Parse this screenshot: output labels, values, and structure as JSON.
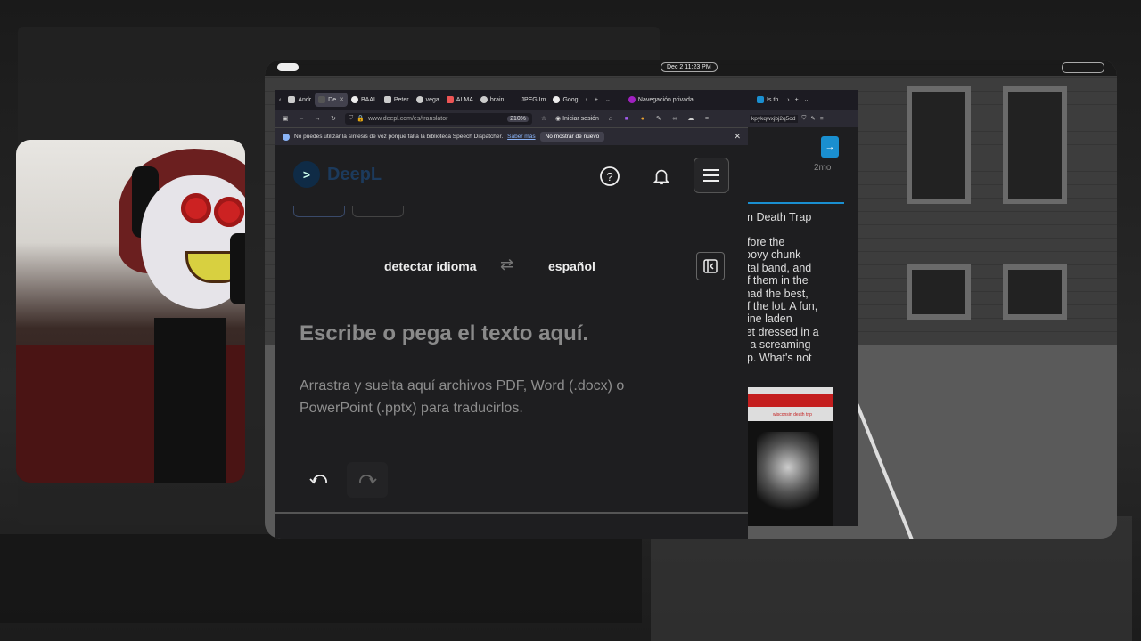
{
  "topbar": {
    "clock": "Dec 2  11:23 PM"
  },
  "browser": {
    "tabs": [
      {
        "label": "Andr",
        "active": false
      },
      {
        "label": "De",
        "active": true
      },
      {
        "label": "BAAL",
        "active": false
      },
      {
        "label": "Peter",
        "active": false
      },
      {
        "label": "vega",
        "active": false
      },
      {
        "label": "ALMA",
        "active": false
      },
      {
        "label": "brain",
        "active": false
      },
      {
        "label": "JPEG Im",
        "active": false
      },
      {
        "label": "Goog",
        "active": false
      }
    ],
    "new_tab": "+",
    "private_label": "Navegación privada",
    "url": "www.deepl.com/es/translator",
    "zoom": "210%",
    "signin": "Iniciar sesión",
    "notice": {
      "text": "No puedes utilizar la síntesis de voz porque falta la biblioteca Speech Dispatcher.",
      "more": "Saber más",
      "dont_show": "No mostrar de nuevo"
    }
  },
  "deepl": {
    "logo": "DeepL",
    "source_lang": "detectar idioma",
    "target_lang": "español",
    "placeholder": "Escribe o pega el texto aquí.",
    "hint": "Arrastra y suelta aquí archivos PDF, Word (.docx) o PowerPoint (.pptx) para traducirlos."
  },
  "side": {
    "tab_label": "Is th",
    "url_fragment": "kpykqwxjbj2q5od",
    "ago": "2mo",
    "title": "sin Death Trap",
    "body": "efore the\nroovy chunk\netal band, and\nof them in the\n had the best,\nof the lot. A fun,\neine laden\nllet dressed in a\nn a screaming\nop. What's not",
    "cover_text": "wisconsin death trip"
  }
}
